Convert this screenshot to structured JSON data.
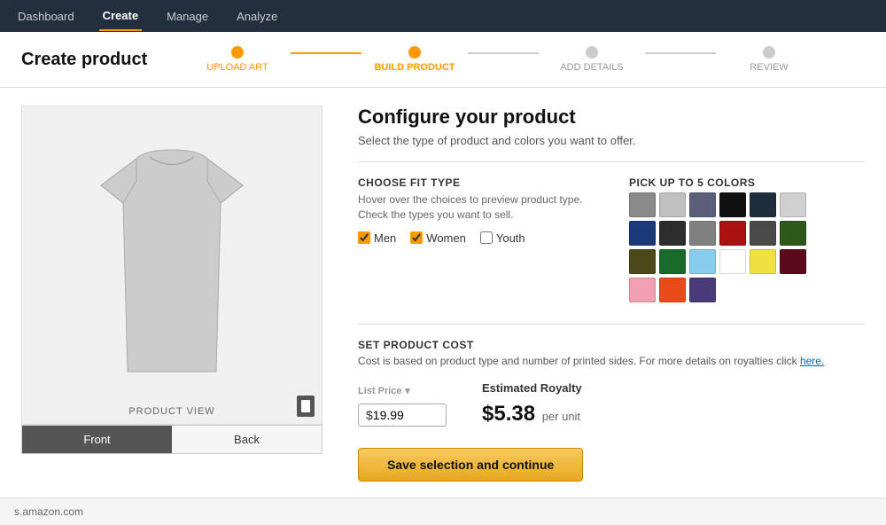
{
  "nav": {
    "items": [
      {
        "label": "Dashboard",
        "active": false
      },
      {
        "label": "Create",
        "active": true
      },
      {
        "label": "Manage",
        "active": false
      },
      {
        "label": "Analyze",
        "active": false
      }
    ]
  },
  "page": {
    "title": "Create product"
  },
  "steps": [
    {
      "label": "UPLOAD ART",
      "state": "done"
    },
    {
      "label": "BUILD PRODUCT",
      "state": "active"
    },
    {
      "label": "ADD DETAILS",
      "state": "inactive"
    },
    {
      "label": "REVIEW",
      "state": "inactive"
    }
  ],
  "configure": {
    "heading": "Configure your product",
    "subtitle": "Select the type of product and colors you want to offer.",
    "fit_type": {
      "label": "CHOOSE FIT TYPE",
      "desc_line1": "Hover over the choices to preview product type.",
      "desc_line2": "Check the types you want to sell.",
      "options": [
        {
          "label": "Men",
          "checked": true
        },
        {
          "label": "Women",
          "checked": true
        },
        {
          "label": "Youth",
          "checked": false
        }
      ]
    },
    "colors": {
      "label": "PICK UP TO 5 COLORS",
      "swatches": [
        "#8a8a8a",
        "#c0c0c0",
        "#5a5f7a",
        "#111111",
        "#1e2d3d",
        "#d0d0d0",
        "#1a3a7a",
        "#2d2d2d",
        "#808080",
        "#aa1111",
        "#4a4a4a",
        "#2d5a1a",
        "#4a4a1a",
        "#1a6a2a",
        "#88ccee",
        "#ffffff",
        "#f0e040",
        "#5a0a1a",
        "#f0a0b0",
        "#e84a1a",
        "#4a3a7a"
      ]
    }
  },
  "cost": {
    "label": "SET PRODUCT COST",
    "desc": "Cost is based on product type and number of printed sides. For more details on royalties click",
    "link_text": "here.",
    "list_price_label": "List Price",
    "list_price_symbol": "$",
    "list_price_value": "19.99",
    "royalty_label": "Estimated Royalty",
    "royalty_value": "$5.38",
    "royalty_unit": "per unit"
  },
  "product_view": {
    "label": "PRODUCT VIEW",
    "buttons": [
      {
        "label": "Front",
        "active": true
      },
      {
        "label": "Back",
        "active": false
      }
    ]
  },
  "save_button": {
    "label": "Save selection and continue"
  },
  "bottom_bar": {
    "text": "s.amazon.com"
  }
}
